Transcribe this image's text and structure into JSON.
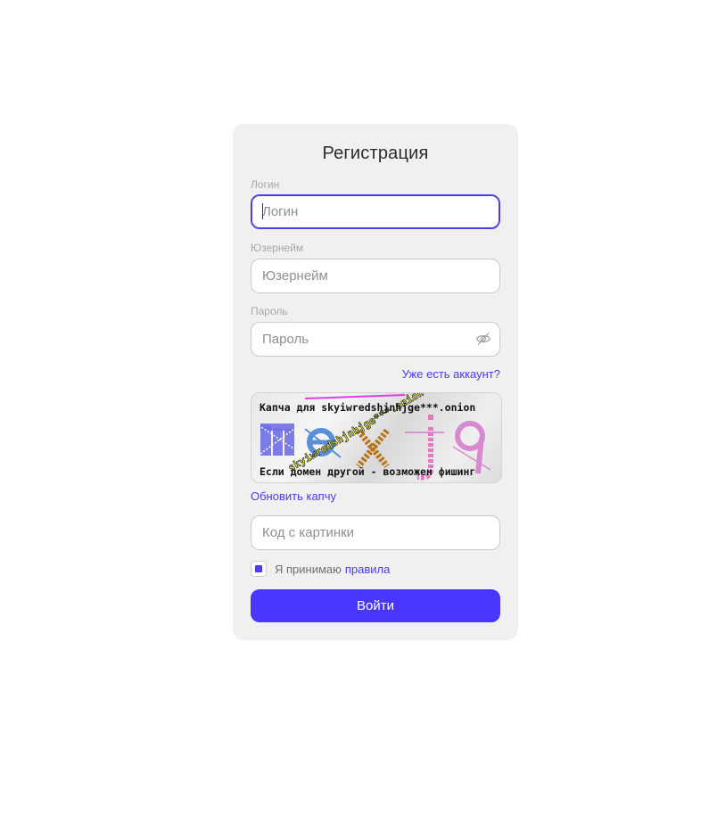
{
  "form": {
    "title": "Регистрация",
    "login": {
      "label": "Логин",
      "placeholder": "Логин"
    },
    "username": {
      "label": "Юзернейм",
      "placeholder": "Юзернейм"
    },
    "password": {
      "label": "Пароль",
      "placeholder": "Пароль"
    },
    "have_account_link": "Уже есть аккаунт?",
    "captcha": {
      "line1": "Капча для skyiwredshjnhjge***.onion",
      "line2": "Если домен другой - возможен фишинг",
      "distorted_domain": "skyiwredshjnhjge***.onion"
    },
    "refresh_captcha_link": "Обновить капчу",
    "code": {
      "placeholder": "Код с картинки"
    },
    "agree_text": "Я принимаю",
    "rules_link": "правила",
    "agree_checked": true,
    "submit_label": "Войти"
  },
  "colors": {
    "accent": "#4937ff",
    "card_bg": "#f0f0f0",
    "label": "#a8a8a8"
  },
  "icons": {
    "password_toggle": "eye-off-icon"
  }
}
